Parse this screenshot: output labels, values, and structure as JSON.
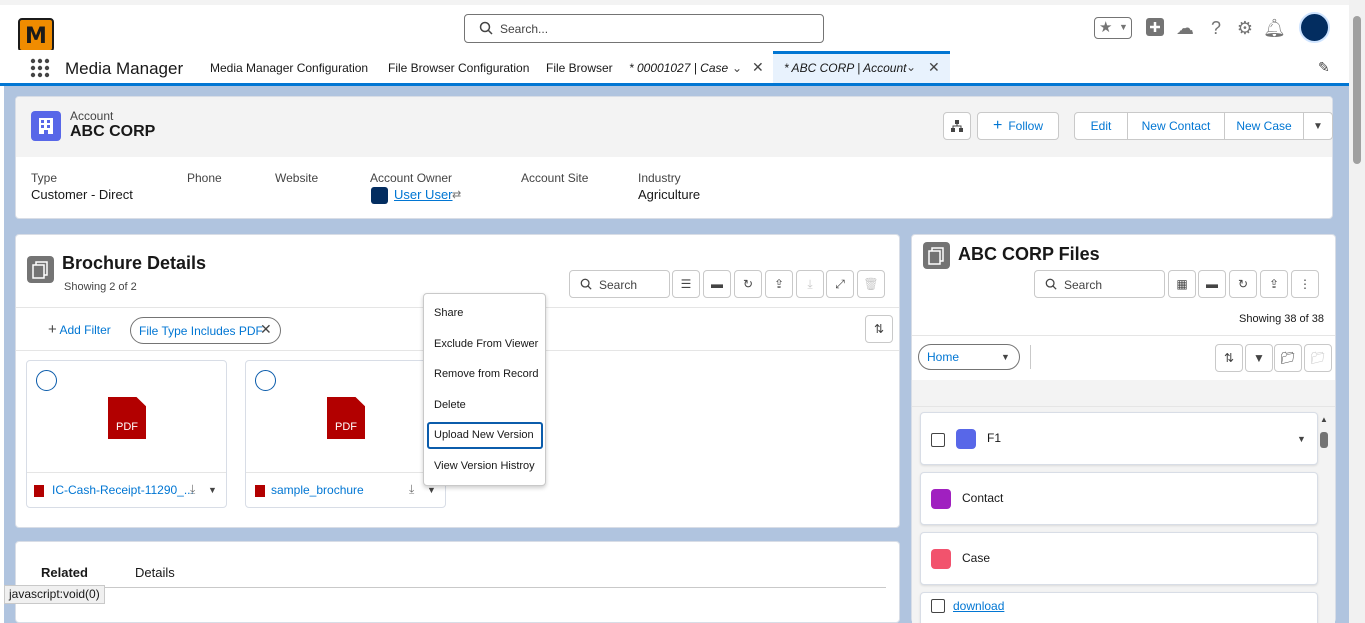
{
  "search_placeholder": "Search...",
  "app_name": "Media Manager",
  "logo_text": "M",
  "nav_tabs": [
    "Media Manager Configuration",
    "File Browser Configuration",
    "File Browser",
    "* 00001027 | Case",
    "* ABC CORP | Account"
  ],
  "record": {
    "object": "Account",
    "name": "ABC CORP",
    "buttons": [
      "Follow",
      "Edit",
      "New Contact",
      "New Case"
    ],
    "fields": [
      {
        "label": "Type",
        "value": "Customer - Direct"
      },
      {
        "label": "Phone",
        "value": ""
      },
      {
        "label": "Website",
        "value": ""
      },
      {
        "label": "Account Owner",
        "value": "User User"
      },
      {
        "label": "Account Site",
        "value": ""
      },
      {
        "label": "Industry",
        "value": "Agriculture"
      }
    ]
  },
  "brochure": {
    "title": "Brochure Details",
    "count": "Showing 2 of 2",
    "search_placeholder": "Search",
    "add_filter": "Add Filter",
    "filter_pill": "File Type Includes PDF",
    "files": [
      {
        "name": "IC-Cash-Receipt-11290_...",
        "thumb": "PDF"
      },
      {
        "name": "sample_brochure",
        "thumb": "PDF"
      }
    ]
  },
  "context_menu": [
    "Share",
    "Exclude From Viewer",
    "Remove from Record",
    "Delete",
    "Upload New Version",
    "View Version Histroy"
  ],
  "files_panel": {
    "title": "ABC CORP Files",
    "search_placeholder": "Search",
    "count": "Showing 38 of 38",
    "folder_select": "Home",
    "items": [
      "F1",
      "Contact",
      "Case",
      "download"
    ]
  },
  "related_tabs": [
    "Related",
    "Details"
  ],
  "status_text": "javascript:void(0)",
  "colors": {
    "brand": "#0176d3",
    "background": "#b0c4df",
    "pdf": "#b20000"
  }
}
